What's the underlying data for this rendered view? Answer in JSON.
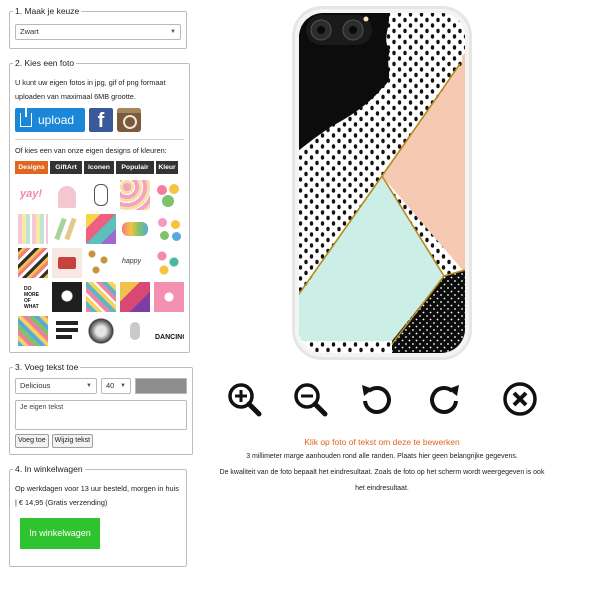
{
  "sections": {
    "choice": {
      "legend": "1. Maak je keuze",
      "select_value": "Zwart"
    },
    "photo": {
      "legend": "2. Kies een foto",
      "description": "U kunt uw eigen fotos in jpg, gif of png formaat uploaden van maximaal 6MB grootte.",
      "upload_label": "upload",
      "facebook_icon_glyph": "f",
      "designs_intro": "Of kies een van onze eigen designs of kleuren:",
      "tabs": [
        "Designs",
        "GiftArt",
        "Iconen",
        "Populair",
        "Kleur"
      ]
    },
    "text": {
      "legend": "3. Voeg tekst toe",
      "font_value": "Delicious",
      "size_value": "40",
      "text_value": "Je eigen tekst",
      "add_button": "Voeg toe",
      "edit_button": "Wijzig tekst",
      "color_value": "#8d8d8d"
    },
    "cart": {
      "legend": "4. In winkelwagen",
      "info": "Op werkdagen voor 13 uur besteld, morgen in huis | € 14,95 (Gratis verzending)",
      "button_label": "In winkelwagen"
    }
  },
  "icons": [
    "zoom-in-icon",
    "zoom-out-icon",
    "rotate-left-icon",
    "rotate-right-icon",
    "remove-icon"
  ],
  "info": {
    "edit_hint": "Klik op foto of tekst om deze te bewerken",
    "margin_note": "3 millimeter marge aanhouden rond alle randen. Plaats hier geen belangrijke gegevens.",
    "quality_note_1": "De kwaliteit van de foto bepaalt het eindresultaat. Zoals de foto op het scherm wordt weergegeven is ook",
    "quality_note_2": "het eindresultaat."
  },
  "colors": {
    "accent": "#e0651e",
    "upload_blue": "#1a87d8",
    "cart_green": "#2fc32f",
    "phone_mint": "#cbeee6",
    "phone_peach": "#f6c9b3",
    "gold_line": "#b58a1e"
  }
}
